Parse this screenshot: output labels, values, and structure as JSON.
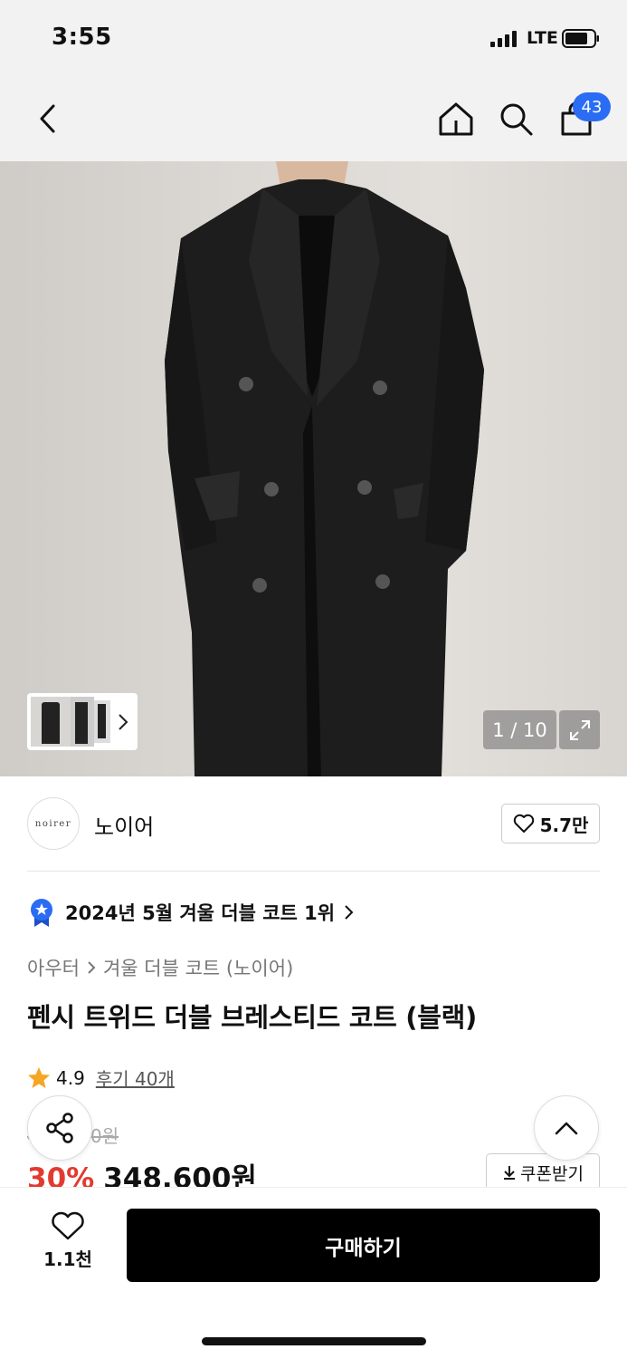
{
  "status_bar": {
    "time": "3:55",
    "network": "LTE"
  },
  "nav": {
    "cart_count": "43"
  },
  "gallery": {
    "pager": "1 / 10"
  },
  "brand": {
    "logo_text": "noirer",
    "name": "노이어",
    "likes": "5.7만"
  },
  "ranking": {
    "text": "2024년 5월 겨울 더블 코트 1위"
  },
  "breadcrumb": {
    "level1": "아우터",
    "level2": "겨울 더블 코트 (노이어)"
  },
  "product": {
    "title": "펜시 트위드 더블 브레스티드 코트 (블랙)",
    "rating": "4.9",
    "reviews": "후기 40개",
    "original_price": "498,000원",
    "discount": "30%",
    "price": "348,600원"
  },
  "coupon": {
    "label": "쿠폰받기"
  },
  "bottom": {
    "wish_count": "1.1천",
    "buy_label": "구매하기"
  },
  "colors": {
    "badge": "#2a6df4",
    "discount": "#e33a2f",
    "rank_badge": "#2a6df4",
    "star": "#f5a623"
  }
}
